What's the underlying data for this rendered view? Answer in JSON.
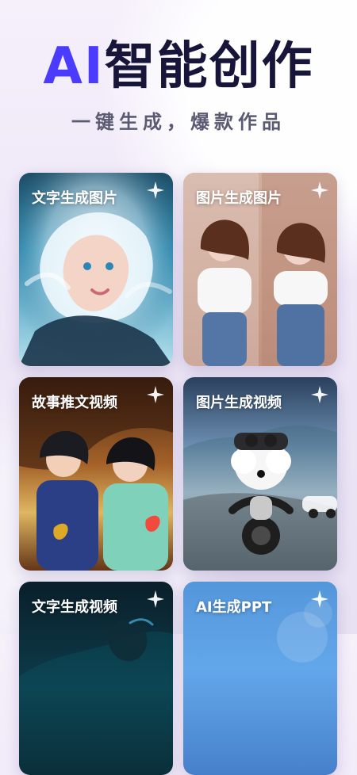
{
  "header": {
    "title_prefix": "AI",
    "title_suffix": "智能创作",
    "subtitle": "一键生成，爆款作品"
  },
  "cards": [
    {
      "label": "文字生成图片"
    },
    {
      "label": "图片生成图片"
    },
    {
      "label": "故事推文视频"
    },
    {
      "label": "图片生成视频"
    },
    {
      "label": "文字生成视频"
    },
    {
      "label": "AI生成PPT"
    }
  ],
  "colors": {
    "accent": "#4b3bff",
    "title_dark": "#17163a",
    "subtitle": "#5a5a72"
  },
  "icons": {
    "sparkle": "sparkle-icon"
  }
}
